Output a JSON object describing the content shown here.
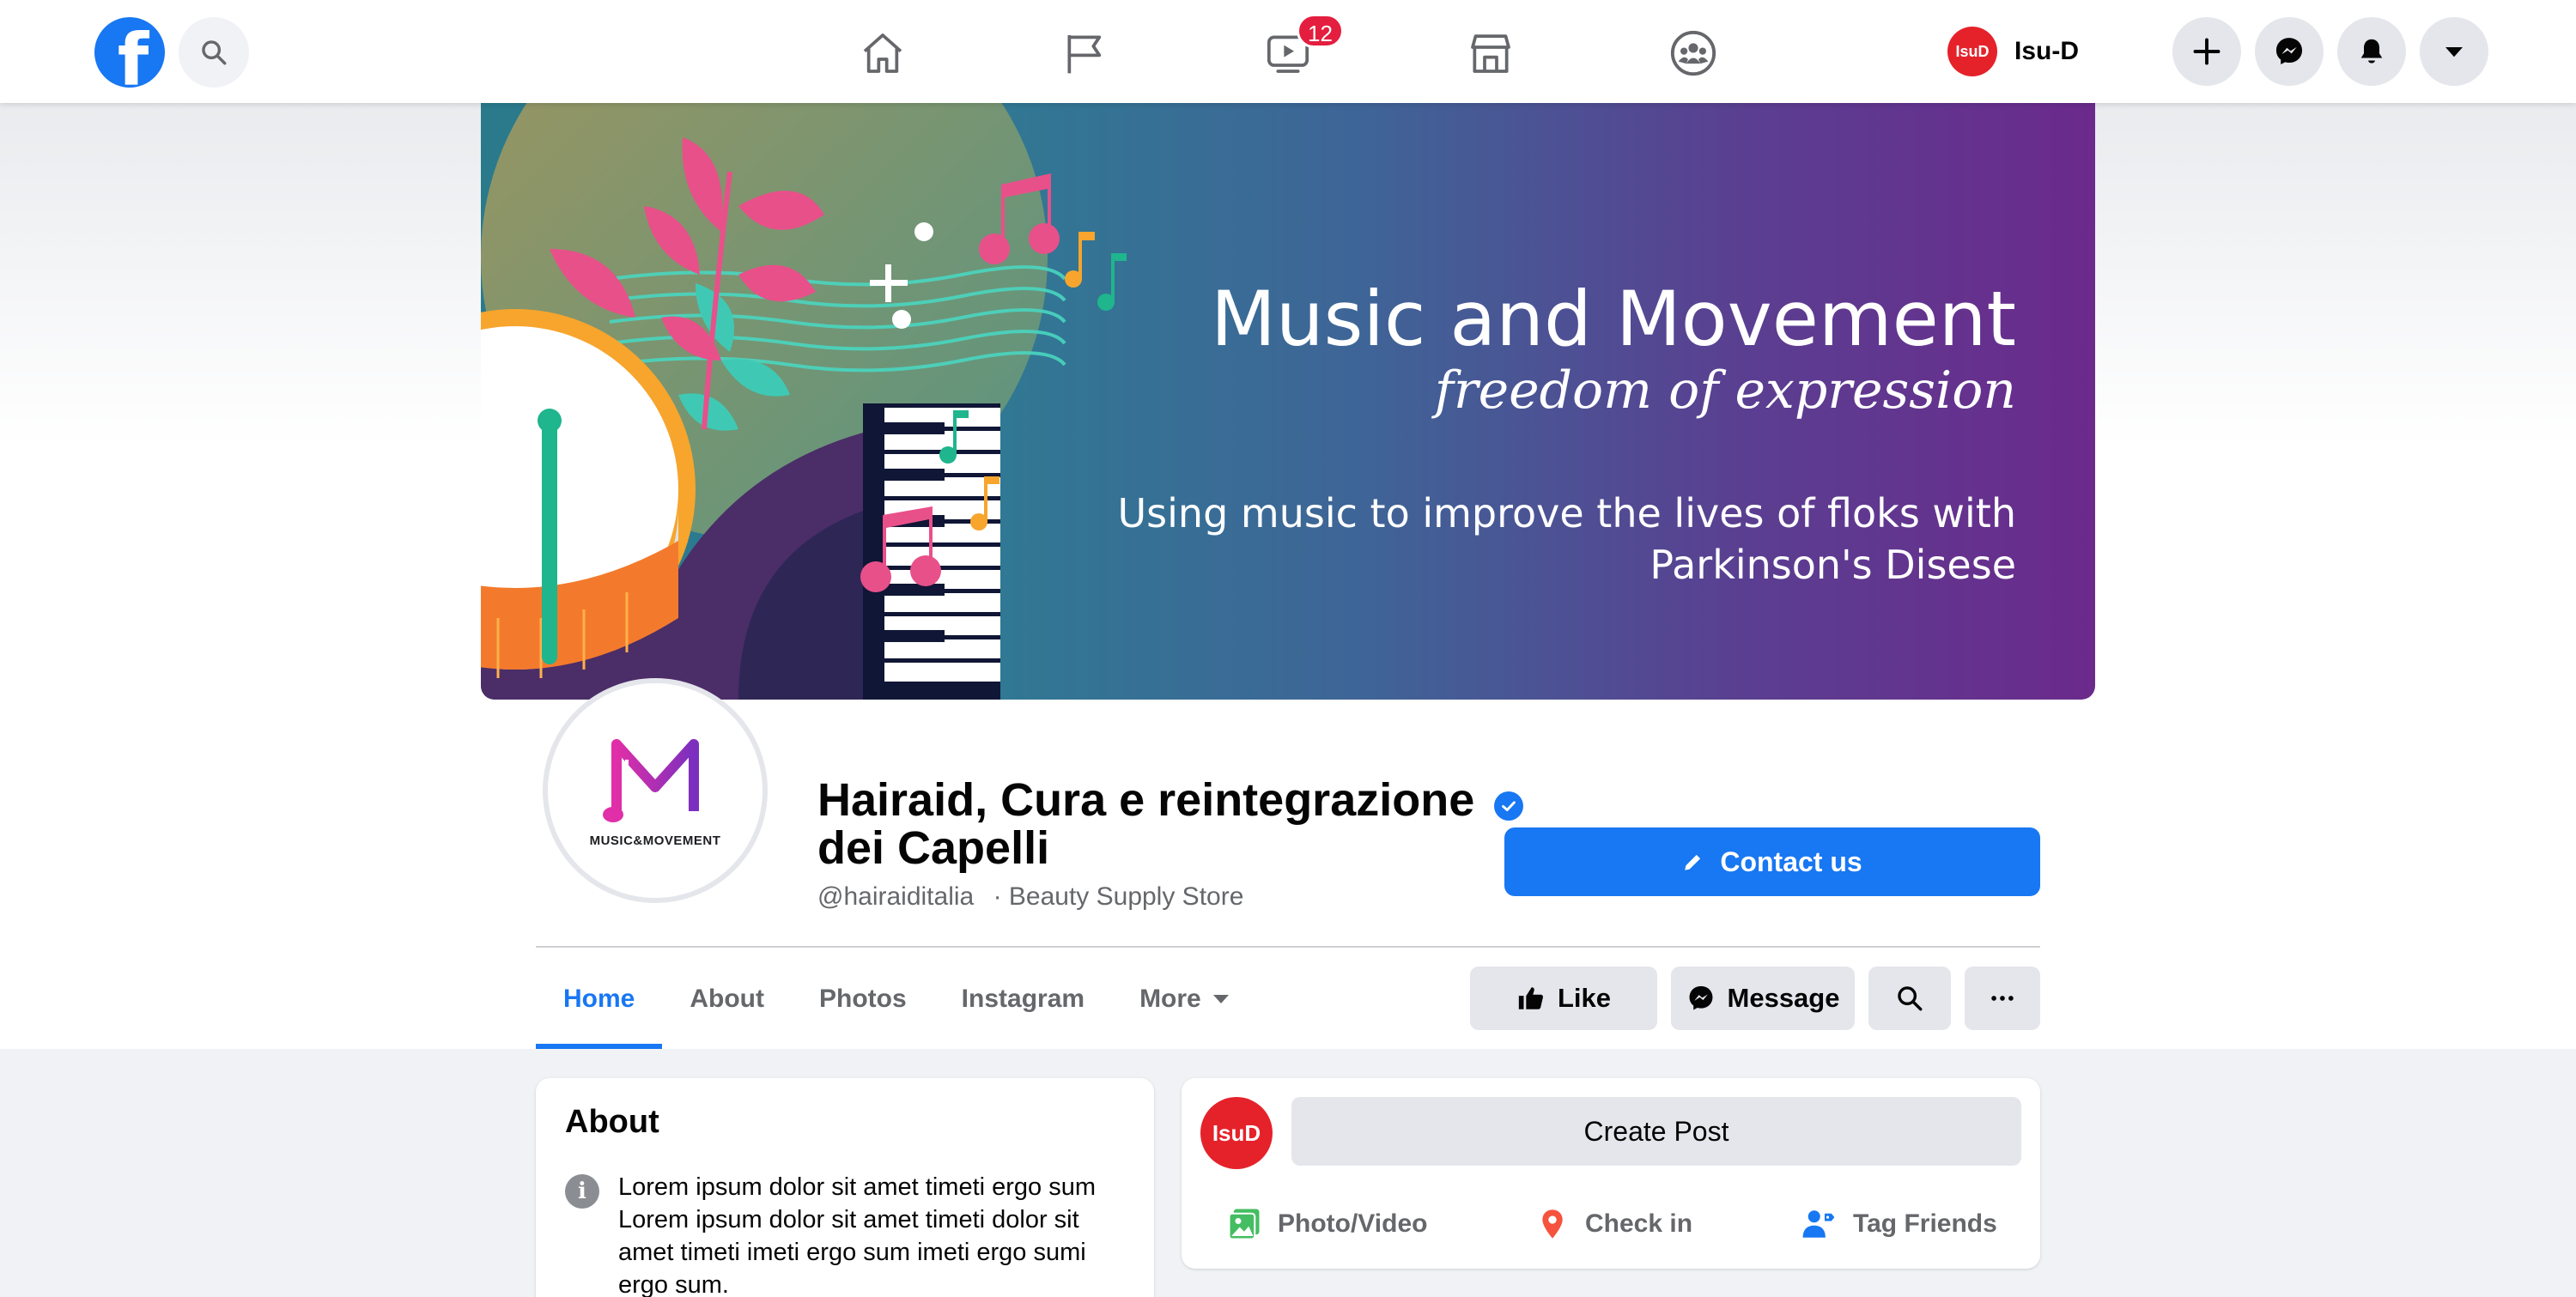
{
  "topbar": {
    "video_badge": "12",
    "user_name": "Isu-D",
    "user_avatar_text": "IsuD"
  },
  "cover": {
    "title": "Music and Movement",
    "subtitle": "freedom of expression",
    "text": "Using music to improve the lives of floks with Parkinson's Disese"
  },
  "profile": {
    "logo_text": "MUSIC&MOVEMENT",
    "name": "Hairaid, Cura e reintegrazione dei Capelli",
    "handle": "@hairaiditalia",
    "category": "· Beauty Supply Store",
    "contact_label": "Contact us"
  },
  "tabs": [
    {
      "label": "Home"
    },
    {
      "label": "About"
    },
    {
      "label": "Photos"
    },
    {
      "label": "Instagram"
    },
    {
      "label": "More"
    }
  ],
  "actions": {
    "like": "Like",
    "message": "Message"
  },
  "about": {
    "title": "About",
    "info_glyph": "i",
    "text": "Lorem ipsum dolor sit amet timeti ergo sum Lorem ipsum dolor sit amet timeti dolor sit amet timeti imeti ergo sum imeti ergo sumi ergo sum."
  },
  "composer": {
    "avatar_text": "IsuD",
    "create_post": "Create Post",
    "photo_video": "Photo/Video",
    "check_in": "Check in",
    "tag_friends": "Tag Friends"
  },
  "colors": {
    "brand_blue": "#1877f2",
    "badge_red": "#e41e3f",
    "avatar_red": "#e5222a"
  }
}
